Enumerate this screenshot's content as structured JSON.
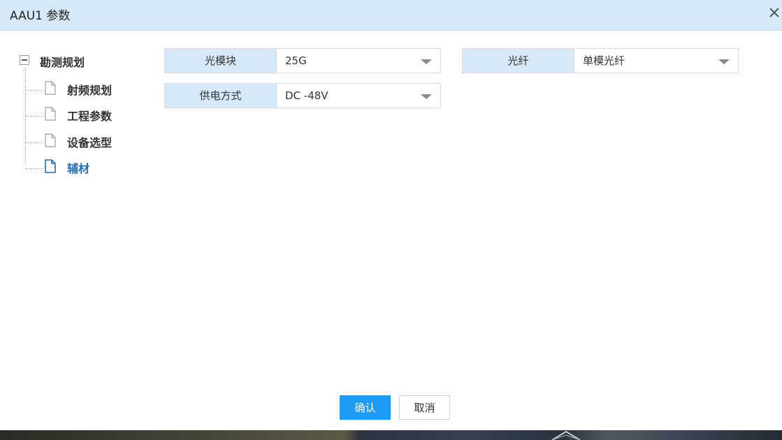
{
  "dialog": {
    "title": "AAU1 参数",
    "close_glyph": "✕"
  },
  "tree": {
    "root": {
      "label": "勘测规划",
      "expanded": true
    },
    "children": [
      {
        "label": "射频规划",
        "active": false
      },
      {
        "label": "工程参数",
        "active": false
      },
      {
        "label": "设备选型",
        "active": false
      },
      {
        "label": "辅材",
        "active": true
      }
    ]
  },
  "form": {
    "fields": [
      {
        "label": "光模块",
        "value": "25G"
      },
      {
        "label": "光纤",
        "value": "单模光纤"
      },
      {
        "label": "供电方式",
        "value": "DC -48V"
      }
    ]
  },
  "buttons": {
    "confirm": "确认",
    "cancel": "取消"
  },
  "colors": {
    "header_bg": "#d6e9f8",
    "label_bg": "#d6e9f8",
    "primary": "#1e9cf5",
    "active_tree": "#1f6fb5"
  },
  "icons": {
    "collapse": "minus-square-icon",
    "tree_item": "document-icon",
    "close": "close-icon",
    "dropdown": "caret-down-icon"
  }
}
